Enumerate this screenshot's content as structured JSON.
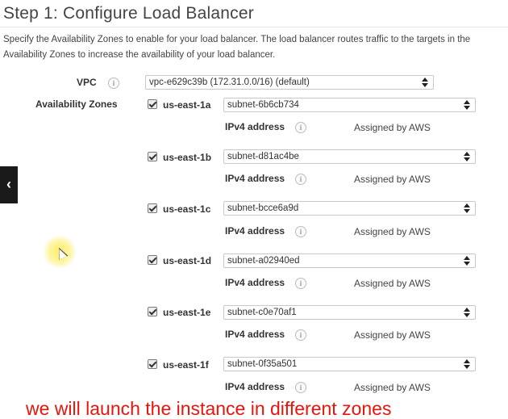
{
  "header": {
    "title": "Step 1: Configure Load Balancer",
    "description_line1": "Specify the Availability Zones to enable for your load balancer. The load balancer routes traffic to the targets in the",
    "description_line2": "Availability Zones to increase the availability of your load balancer."
  },
  "vpc": {
    "label": "VPC",
    "value": "vpc-e629c39b (172.31.0.0/16) (default)"
  },
  "availability_zones": {
    "label": "Availability Zones",
    "zones": [
      {
        "name": "us-east-1a",
        "checked": true,
        "subnet": "subnet-6b6cb734",
        "ipv4_label": "IPv4 address",
        "ipv4_value": "Assigned by AWS"
      },
      {
        "name": "us-east-1b",
        "checked": true,
        "subnet": "subnet-d81ac4be",
        "ipv4_label": "IPv4 address",
        "ipv4_value": "Assigned by AWS"
      },
      {
        "name": "us-east-1c",
        "checked": true,
        "subnet": "subnet-bcce6a9d",
        "ipv4_label": "IPv4 address",
        "ipv4_value": "Assigned by AWS"
      },
      {
        "name": "us-east-1d",
        "checked": true,
        "subnet": "subnet-a02940ed",
        "ipv4_label": "IPv4 address",
        "ipv4_value": "Assigned by AWS"
      },
      {
        "name": "us-east-1e",
        "checked": true,
        "subnet": "subnet-c0e70af1",
        "ipv4_label": "IPv4 address",
        "ipv4_value": "Assigned by AWS"
      },
      {
        "name": "us-east-1f",
        "checked": true,
        "subnet": "subnet-0f35a501",
        "ipv4_label": "IPv4 address",
        "ipv4_value": "Assigned by AWS"
      }
    ]
  },
  "overlay": {
    "back_icon": "chevron-left-icon",
    "caption": "we will launch the instance in different zones",
    "caption_color": "#e8150c"
  }
}
